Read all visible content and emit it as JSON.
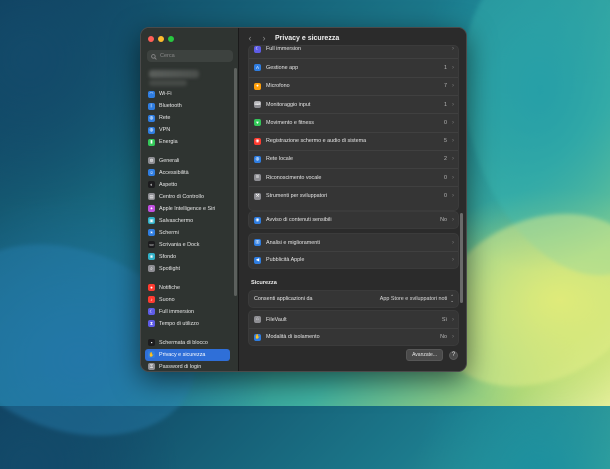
{
  "window": {
    "title": "Privacy e sicurezza",
    "colors": {
      "close": "#ff5f57",
      "minimize": "#febc2e",
      "zoom": "#28c840",
      "accent": "#2f6fd8"
    }
  },
  "search": {
    "placeholder": "Cerca",
    "value": ""
  },
  "sidebar": {
    "items": [
      {
        "label": "Wi-Fi",
        "icon": "wifi-icon",
        "color": "#2f7de1"
      },
      {
        "label": "Bluetooth",
        "icon": "bluetooth-icon",
        "color": "#2f7de1"
      },
      {
        "label": "Rete",
        "icon": "globe-icon",
        "color": "#2f7de1"
      },
      {
        "label": "VPN",
        "icon": "vpn-icon",
        "color": "#2f7de1"
      },
      {
        "label": "Energia",
        "icon": "battery-icon",
        "color": "#34c759"
      },
      {
        "label": "Generali",
        "icon": "gear-icon",
        "color": "#8e8e93"
      },
      {
        "label": "Accessibilità",
        "icon": "accessibility-icon",
        "color": "#2f7de1"
      },
      {
        "label": "Aspetto",
        "icon": "appearance-icon",
        "color": "#1c1c1e"
      },
      {
        "label": "Centro di Controllo",
        "icon": "control-center-icon",
        "color": "#8e8e93"
      },
      {
        "label": "Apple Intelligence e Siri",
        "icon": "siri-icon",
        "color": "#c050e0"
      },
      {
        "label": "Salvaschermo",
        "icon": "screensaver-icon",
        "color": "#30b0c7"
      },
      {
        "label": "Schermi",
        "icon": "display-icon",
        "color": "#2f7de1"
      },
      {
        "label": "Scrivania e Dock",
        "icon": "dock-icon",
        "color": "#1c1c1e"
      },
      {
        "label": "Sfondo",
        "icon": "wallpaper-icon",
        "color": "#30b0c7"
      },
      {
        "label": "Spotlight",
        "icon": "spotlight-icon",
        "color": "#8e8e93"
      },
      {
        "label": "Notifiche",
        "icon": "bell-icon",
        "color": "#ff3b30"
      },
      {
        "label": "Suono",
        "icon": "speaker-icon",
        "color": "#ff3b30"
      },
      {
        "label": "Full immersion",
        "icon": "moon-icon",
        "color": "#5e5ce6"
      },
      {
        "label": "Tempo di utilizzo",
        "icon": "hourglass-icon",
        "color": "#5e5ce6"
      },
      {
        "label": "Schermata di blocco",
        "icon": "lock-screen-icon",
        "color": "#1c1c1e"
      },
      {
        "label": "Privacy e sicurezza",
        "icon": "hand-icon",
        "color": "#2f7de1",
        "active": true
      },
      {
        "label": "Password di login",
        "icon": "key-icon",
        "color": "#8e8e93"
      }
    ]
  },
  "privacy_rows": [
    {
      "label": "Full immersion",
      "value": "",
      "icon": "moon-icon",
      "color": "#5e5ce6"
    },
    {
      "label": "Gestione app",
      "value": "1",
      "icon": "app-store-icon",
      "color": "#2f7de1"
    },
    {
      "label": "Microfono",
      "value": "7",
      "icon": "microphone-icon",
      "color": "#ff9f0a"
    },
    {
      "label": "Monitoraggio input",
      "value": "1",
      "icon": "keyboard-icon",
      "color": "#8e8e93"
    },
    {
      "label": "Movimento e fitness",
      "value": "0",
      "icon": "fitness-icon",
      "color": "#34c759"
    },
    {
      "label": "Registrazione schermo e audio di sistema",
      "value": "5",
      "icon": "record-icon",
      "color": "#ff3b30"
    },
    {
      "label": "Rete locale",
      "value": "2",
      "icon": "network-icon",
      "color": "#2f7de1"
    },
    {
      "label": "Riconoscimento vocale",
      "value": "0",
      "icon": "waveform-icon",
      "color": "#8e8e93"
    },
    {
      "label": "Strumenti per sviluppatori",
      "value": "0",
      "icon": "hammer-icon",
      "color": "#8e8e93"
    }
  ],
  "sensitive": {
    "label": "Avviso di contenuti sensibili",
    "value": "No",
    "icon": "eye-icon",
    "color": "#2f7de1"
  },
  "analysis_rows": [
    {
      "label": "Analisi e miglioramenti",
      "icon": "chart-icon",
      "color": "#2f7de1"
    },
    {
      "label": "Pubblicità Apple",
      "icon": "megaphone-icon",
      "color": "#2f7de1"
    }
  ],
  "security": {
    "title": "Sicurezza",
    "allow_label": "Consenti applicazioni da",
    "allow_value": "App Store e sviluppatori noti",
    "rows": [
      {
        "label": "FileVault",
        "value": "Sì",
        "icon": "filevault-icon",
        "color": "#8e8e93"
      },
      {
        "label": "Modalità di isolamento",
        "value": "No",
        "icon": "lockdown-icon",
        "color": "#2f7de1"
      }
    ]
  },
  "footer": {
    "advanced_label": "Avanzate...",
    "help_label": "?"
  }
}
